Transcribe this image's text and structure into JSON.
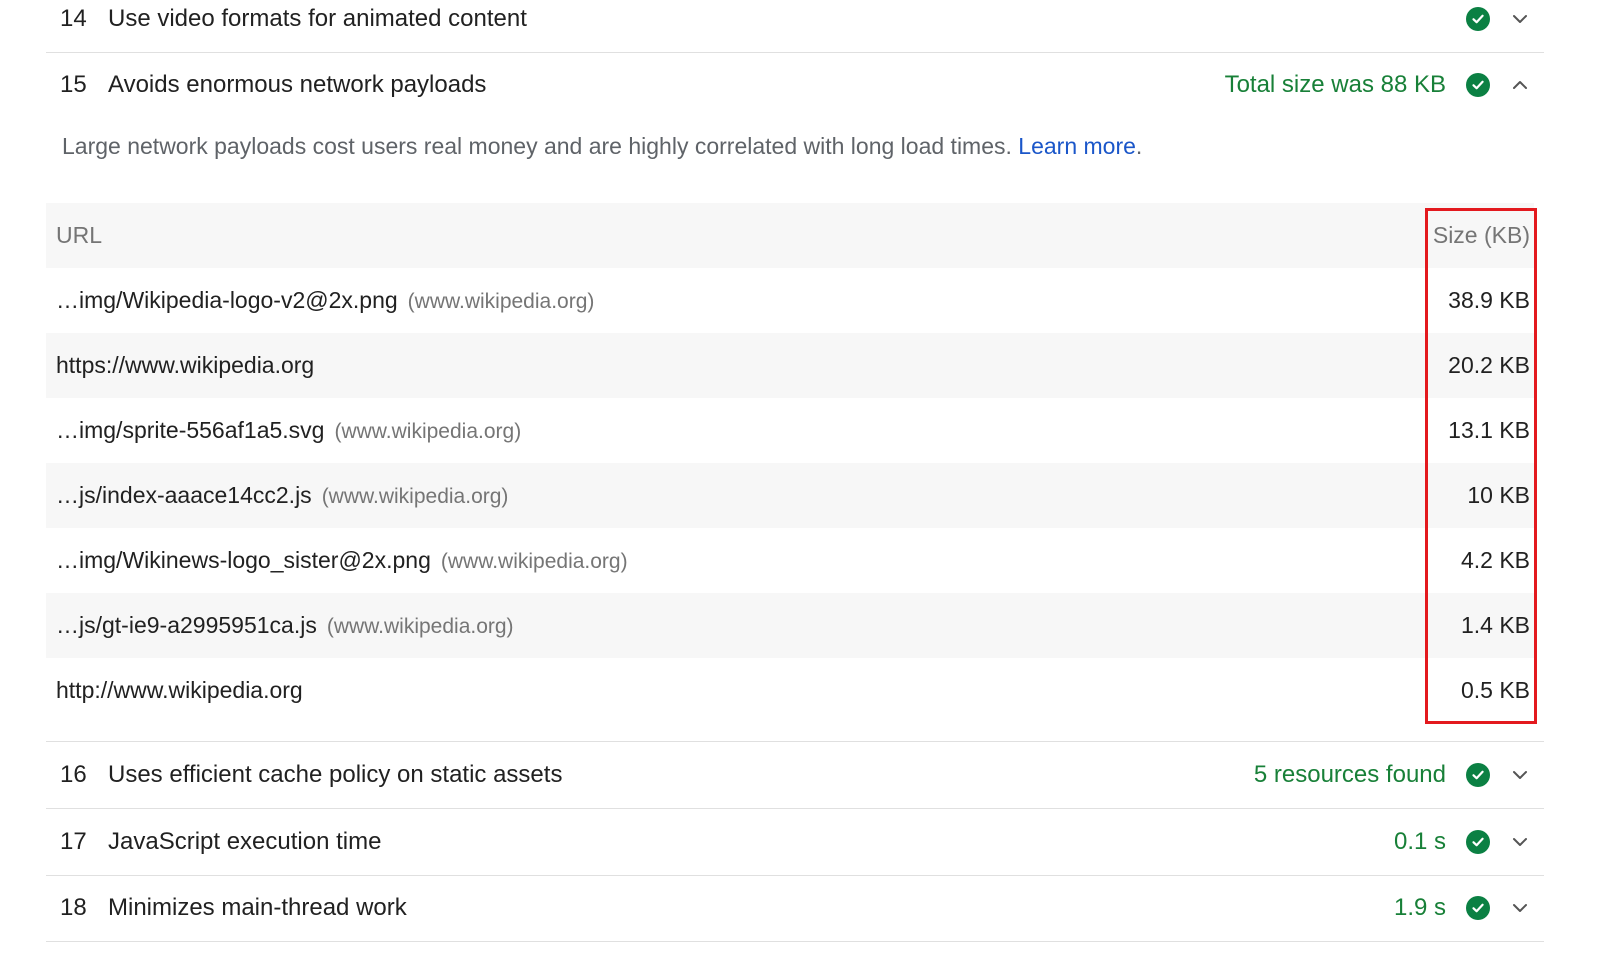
{
  "audits": {
    "a14": {
      "number": "14",
      "title": "Use video formats for animated content",
      "display": ""
    },
    "a15": {
      "number": "15",
      "title": "Avoids enormous network payloads",
      "display": "Total size was 88 KB",
      "description": "Large network payloads cost users real money and are highly correlated with long load times.",
      "learn_more": "Learn more",
      "description_end": "."
    },
    "a16": {
      "number": "16",
      "title": "Uses efficient cache policy on static assets",
      "display": "5 resources found"
    },
    "a17": {
      "number": "17",
      "title": "JavaScript execution time",
      "display": "0.1 s"
    },
    "a18": {
      "number": "18",
      "title": "Minimizes main-thread work",
      "display": "1.9 s"
    }
  },
  "table": {
    "headers": {
      "url": "URL",
      "size": "Size (KB)"
    },
    "rows": [
      {
        "url": "…img/Wikipedia-logo-v2@2x.png",
        "host": "(www.wikipedia.org)",
        "size": "38.9 KB"
      },
      {
        "url": "https://www.wikipedia.org",
        "host": "",
        "size": "20.2 KB"
      },
      {
        "url": "…img/sprite-556af1a5.svg",
        "host": "(www.wikipedia.org)",
        "size": "13.1 KB"
      },
      {
        "url": "…js/index-aaace14cc2.js",
        "host": "(www.wikipedia.org)",
        "size": "10 KB"
      },
      {
        "url": "…img/Wikinews-logo_sister@2x.png",
        "host": "(www.wikipedia.org)",
        "size": "4.2 KB"
      },
      {
        "url": "…js/gt-ie9-a2995951ca.js",
        "host": "(www.wikipedia.org)",
        "size": "1.4 KB"
      },
      {
        "url": "http://www.wikipedia.org",
        "host": "",
        "size": "0.5 KB"
      }
    ]
  },
  "icons": {
    "pass": "check-circle-icon",
    "expand": "chevron-down-icon",
    "collapse": "chevron-up-icon"
  },
  "colors": {
    "pass_green": "#0b8043",
    "display_green": "#188038",
    "link_blue": "#1a56c9",
    "highlight_red": "#e3191e"
  }
}
